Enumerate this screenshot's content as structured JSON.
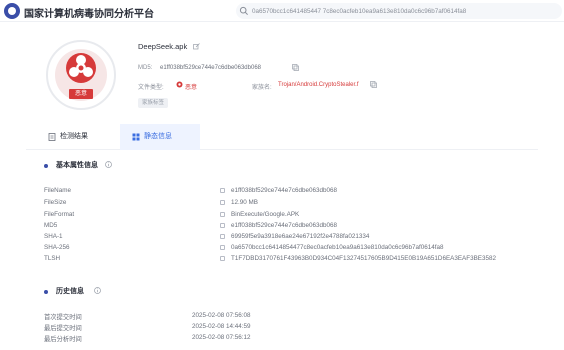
{
  "header": {
    "site_title": "国家计算机病毒协同分析平台",
    "search_value": "0a6570bcc1c641485447 7c8ec0acfeb10ea9a613e810da0c6c96b7af0614fa8"
  },
  "summary": {
    "file_name": "DeepSeek.apk",
    "md5_label": "MD5:",
    "md5_value": "e1ff038bf529ce744e7c6dbe063db068",
    "type_label": "文件类型:",
    "type_value": "恶意",
    "family_label": "家族名:",
    "family_value": "Trojan/Android.CryptoStealer.f",
    "tag_chip": "家族标签",
    "badge_text": "恶意"
  },
  "tabs": [
    {
      "label": "检测结果"
    },
    {
      "label": "静态信息"
    }
  ],
  "basic": {
    "title": "基本属性信息",
    "rows": [
      {
        "label": "FileName",
        "value": "e1ff038bf529ce744e7c6dbe063db068"
      },
      {
        "label": "FileSize",
        "value": "12.90 MB"
      },
      {
        "label": "FileFormat",
        "value": "BinExecute/Google.APK"
      },
      {
        "label": "MD5",
        "value": "e1ff038bf529ce744e7c6dbe063db068"
      },
      {
        "label": "SHA-1",
        "value": "69959f5e9a3918e6ae24e67192f2e4788fa021334"
      },
      {
        "label": "SHA-256",
        "value": "0a6570bcc1c6414854477c8ec0acfeb10ea9a613e810da0c6c96b7af0614fa8"
      },
      {
        "label": "TLSH",
        "value": "T1F7DBD3170761F43963B0D934C04F13274517605B9D415E0B19A651D6EA3EAF3BE3582"
      }
    ]
  },
  "history": {
    "title": "历史信息",
    "rows": [
      {
        "label": "首次提交时间",
        "value": "2025-02-08 07:56:08"
      },
      {
        "label": "最后提交时间",
        "value": "2025-02-08 14:44:59"
      },
      {
        "label": "最后分析时间",
        "value": "2025-02-08 07:56:12"
      }
    ]
  },
  "colors": {
    "accent": "#3a6de0",
    "danger": "#d63a3a",
    "brand": "#3a4ea8"
  }
}
